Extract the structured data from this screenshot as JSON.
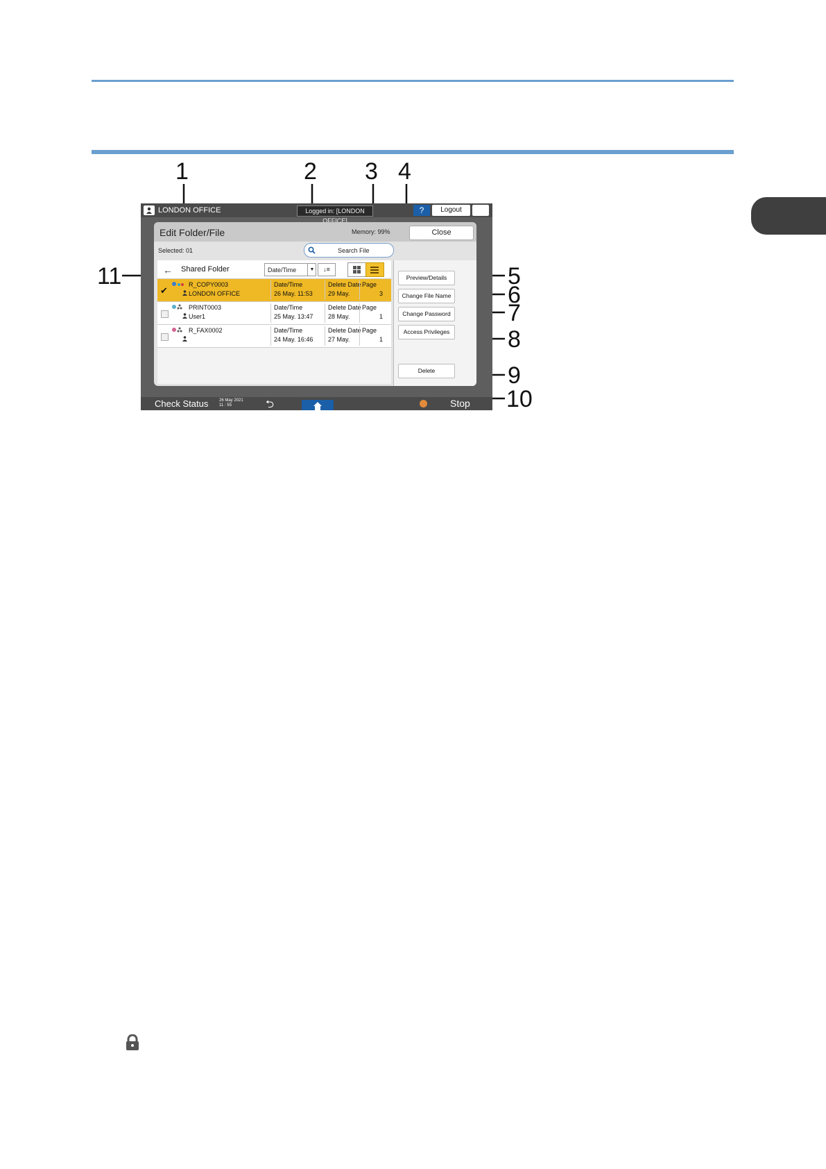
{
  "figure": {
    "callouts": [
      "1",
      "2",
      "3",
      "4",
      "5",
      "6",
      "7",
      "8",
      "9",
      "10",
      "11"
    ]
  },
  "device": {
    "topbar": {
      "user": "LONDON OFFICE",
      "login": "Logged in: [LONDON OFFICE]",
      "help": "?",
      "logout": "Logout"
    },
    "header": {
      "title": "Edit Folder/File",
      "memory": "Memory:  99%",
      "close": "Close"
    },
    "selected": "Selected:    01",
    "search": "Search File",
    "folder": {
      "back": "←",
      "name": "Shared Folder"
    },
    "sort": {
      "value": "Date/Time",
      "caret": "▼",
      "order": "↓≡"
    },
    "files": [
      {
        "name": "R_COPY0003",
        "owner": "LONDON OFFICE",
        "date_label": "Date/Time",
        "date": "26 May.  11:53",
        "delete_label": "Delete Date",
        "delete": "29 May.",
        "page_label": "Page",
        "page": "3",
        "selected": true
      },
      {
        "name": "PRINT0003",
        "owner": "User1",
        "date_label": "Date/Time",
        "date": "25 May.  13:47",
        "delete_label": "Delete Date",
        "delete": "28 May.",
        "page_label": "Page",
        "page": "1",
        "selected": false
      },
      {
        "name": "R_FAX0002",
        "owner": "",
        "date_label": "Date/Time",
        "date": "24 May.  16:46",
        "delete_label": "Delete Date",
        "delete": "27 May.",
        "page_label": "Page",
        "page": "1",
        "selected": false
      }
    ],
    "actions": {
      "preview": "Preview/Details",
      "rename": "Change File Name",
      "password": "Change Password",
      "privileges": "Access Privileges",
      "delete": "Delete"
    },
    "bottombar": {
      "check_status": "Check Status",
      "date": "26 May 2021",
      "time": "11 : 55",
      "back": "⮌",
      "stop": "Stop"
    }
  },
  "colors": {
    "rule": "#6a9fd0",
    "selected_row": "#efb925",
    "help_button": "#1b5fa8"
  }
}
